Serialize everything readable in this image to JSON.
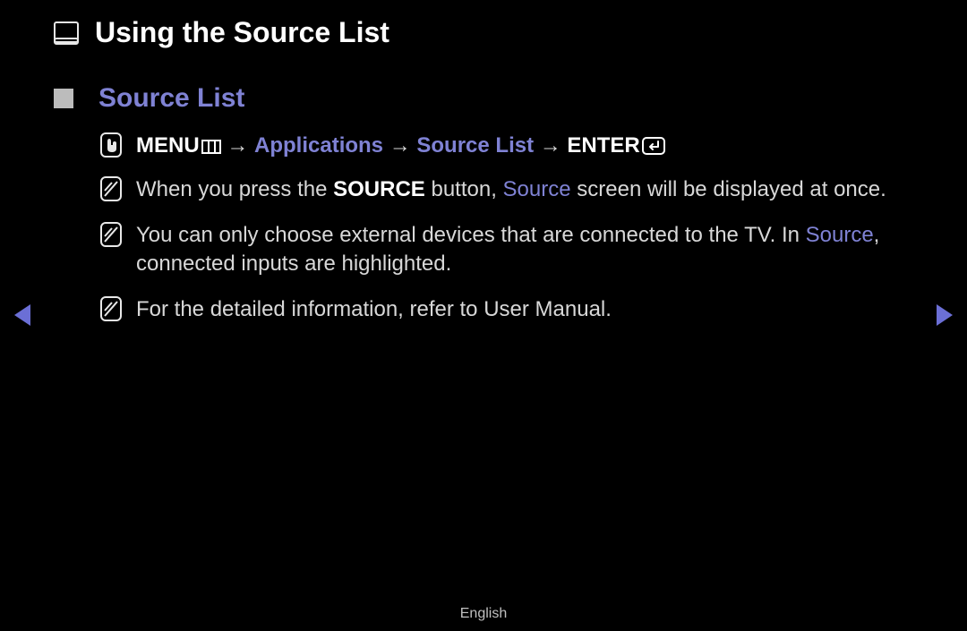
{
  "title": "Using the Source List",
  "section": "Source List",
  "path": {
    "menu": "MENU",
    "applications": "Applications",
    "source_list": "Source List",
    "enter": "ENTER",
    "arrow": "→"
  },
  "notes": {
    "n1": {
      "pre": "When you press the ",
      "source_btn": "SOURCE",
      "mid": " button, ",
      "source_word": "Source",
      "post": " screen will be displayed at once."
    },
    "n2": {
      "pre": "You can only choose external devices that are connected to the TV. In ",
      "source_word": "Source",
      "post": ", connected inputs are highlighted."
    },
    "n3": "For the detailed information, refer to User Manual."
  },
  "footer": "English"
}
